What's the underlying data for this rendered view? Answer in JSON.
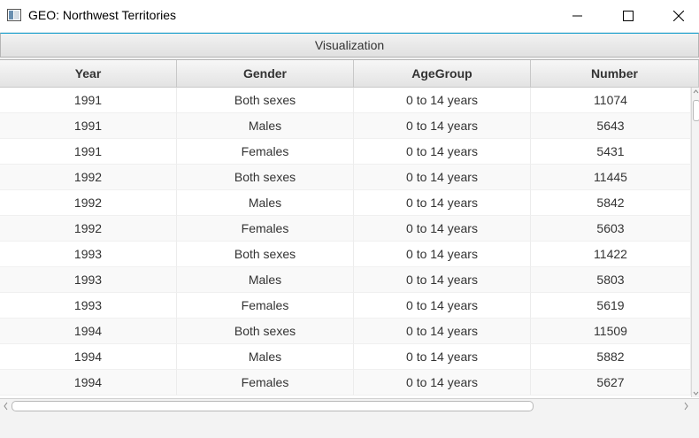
{
  "window": {
    "title": "GEO:  Northwest Territories"
  },
  "toolbar": {
    "visualization_label": "Visualization"
  },
  "table": {
    "columns": [
      "Year",
      "Gender",
      "AgeGroup",
      "Number"
    ],
    "rows": [
      [
        "1991",
        "Both sexes",
        "0 to 14 years",
        "11074"
      ],
      [
        "1991",
        "Males",
        "0 to 14 years",
        "5643"
      ],
      [
        "1991",
        "Females",
        "0 to 14 years",
        "5431"
      ],
      [
        "1992",
        "Both sexes",
        "0 to 14 years",
        "11445"
      ],
      [
        "1992",
        "Males",
        "0 to 14 years",
        "5842"
      ],
      [
        "1992",
        "Females",
        "0 to 14 years",
        "5603"
      ],
      [
        "1993",
        "Both sexes",
        "0 to 14 years",
        "11422"
      ],
      [
        "1993",
        "Males",
        "0 to 14 years",
        "5803"
      ],
      [
        "1993",
        "Females",
        "0 to 14 years",
        "5619"
      ],
      [
        "1994",
        "Both sexes",
        "0 to 14 years",
        "11509"
      ],
      [
        "1994",
        "Males",
        "0 to 14 years",
        "5882"
      ],
      [
        "1994",
        "Females",
        "0 to 14 years",
        "5627"
      ]
    ]
  },
  "icons": {
    "app": "window-icon",
    "minimize": "minimize-icon",
    "maximize": "maximize-icon",
    "close": "close-icon"
  }
}
